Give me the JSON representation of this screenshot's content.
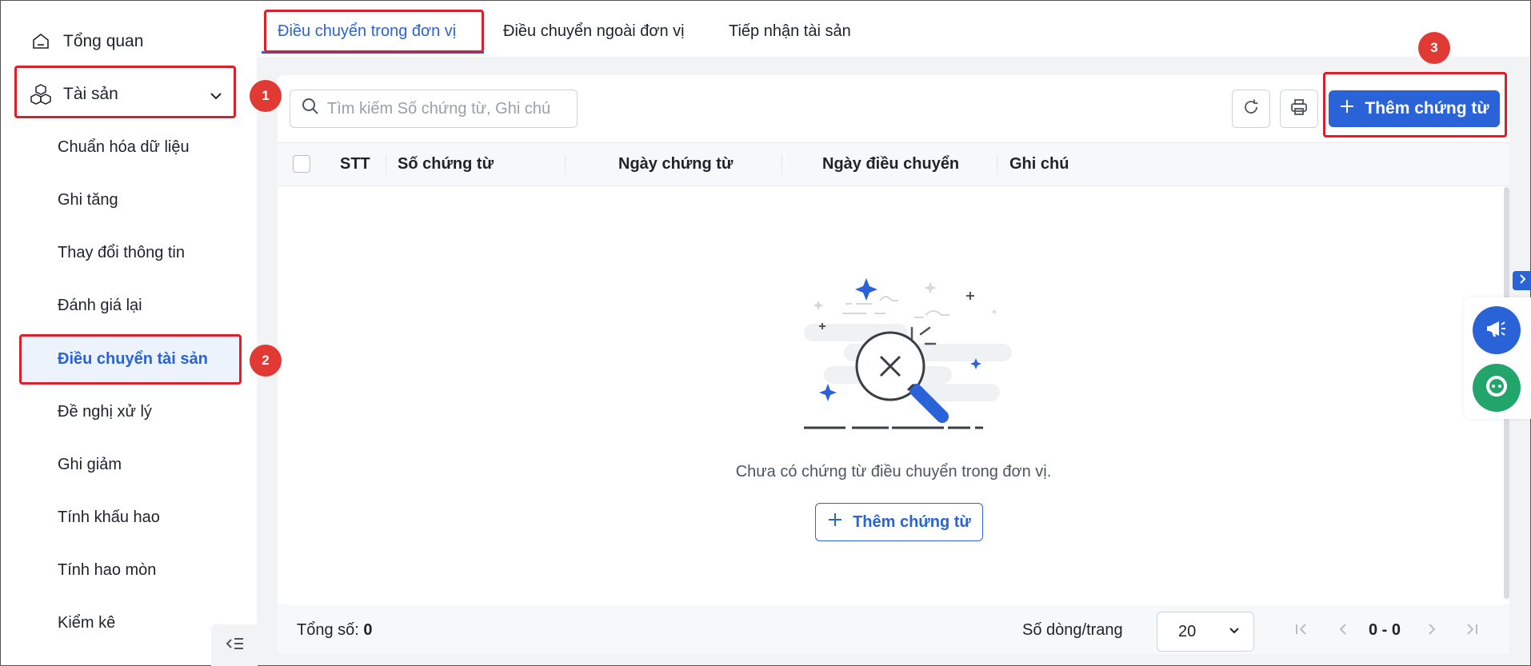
{
  "sidebar": {
    "overview_label": "Tổng quan",
    "assets_label": "Tài sản",
    "items": [
      {
        "label": "Chuẩn hóa dữ liệu"
      },
      {
        "label": "Ghi tăng"
      },
      {
        "label": "Thay đổi thông tin"
      },
      {
        "label": "Đánh giá lại"
      },
      {
        "label": "Điều chuyển tài sản"
      },
      {
        "label": "Đề nghị xử lý"
      },
      {
        "label": "Ghi giảm"
      },
      {
        "label": "Tính khấu hao"
      },
      {
        "label": "Tính hao mòn"
      },
      {
        "label": "Kiểm kê"
      }
    ]
  },
  "tabs": [
    {
      "label": "Điều chuyển trong đơn vị"
    },
    {
      "label": "Điều chuyển ngoài đơn vị"
    },
    {
      "label": "Tiếp nhận tài sản"
    }
  ],
  "toolbar": {
    "search_placeholder": "Tìm kiếm Số chứng từ, Ghi chú",
    "add_label": "Thêm chứng từ"
  },
  "table": {
    "columns": [
      "STT",
      "Số chứng từ",
      "Ngày chứng từ",
      "Ngày điều chuyển",
      "Ghi chú"
    ]
  },
  "empty": {
    "message": "Chưa có chứng từ điều chuyển trong đơn vị.",
    "add_label": "Thêm chứng từ"
  },
  "footer": {
    "total_label": "Tổng số:",
    "total_value": "0",
    "rows_per_page_label": "Số dòng/trang",
    "rows_per_page_value": "20",
    "range": "0 - 0"
  },
  "annotations": [
    "1",
    "2",
    "3"
  ],
  "colors": {
    "accent": "#2a62d8",
    "highlight": "#e21d2a",
    "badge": "#e13a35"
  }
}
